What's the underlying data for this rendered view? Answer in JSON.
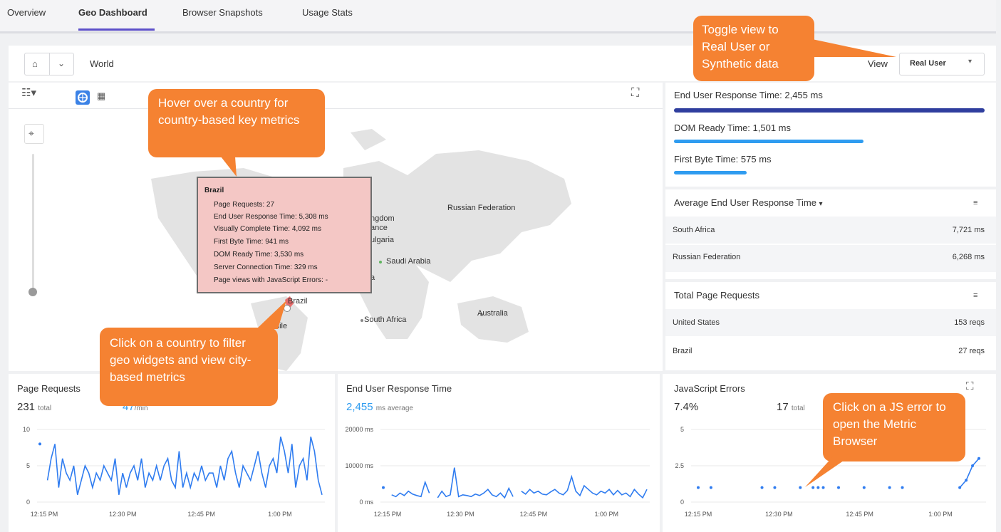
{
  "tabs": [
    "Overview",
    "Geo Dashboard",
    "Browser Snapshots",
    "Usage Stats"
  ],
  "breadcrumb": {
    "location": "World"
  },
  "view": {
    "label": "View",
    "selected": "Real User"
  },
  "callouts": {
    "toggle": "Toggle view to Real User or Synthetic data",
    "hover": "Hover over a country for country-based key metrics",
    "click": "Click on a country to filter geo widgets and view city-based metrics",
    "js": "Click on a JS error to open the Metric Browser"
  },
  "tooltip": {
    "title": "Brazil",
    "lines": [
      "Page Requests: 27",
      "End User Response Time: 5,308 ms",
      "Visually Complete Time: 4,092 ms",
      "First Byte Time: 941 ms",
      "DOM Ready Time: 3,530 ms",
      "Server Connection Time: 329 ms",
      "Page views with JavaScript Errors: -"
    ]
  },
  "map_labels": {
    "russia": "Russian Federation",
    "kingdom": "ngdom",
    "bulgaria": "ulgaria",
    "saudi": "Saudi Arabia",
    "south_africa": "South Africa",
    "australia": "Australia",
    "brazil": "Brazil",
    "chile": "hile",
    "partial_a": "a",
    "partial_gdom": "ance"
  },
  "metrics": {
    "eurt": {
      "label": "End User Response Time: 2,455 ms",
      "fraction": 1.0,
      "color": "#2f3e9e"
    },
    "dom": {
      "label": "DOM Ready Time: 1,501 ms",
      "fraction": 0.611,
      "color": "#2f9cf0"
    },
    "fbt": {
      "label": "First Byte Time: 575 ms",
      "fraction": 0.234,
      "color": "#2f9cf0"
    }
  },
  "avg_eurt": {
    "title": "Average End User Response Time",
    "rows": [
      {
        "name": "South Africa",
        "value": "7,721 ms"
      },
      {
        "name": "Russian Federation",
        "value": "6,268 ms"
      }
    ]
  },
  "total_page_requests": {
    "title": "Total Page Requests",
    "rows": [
      {
        "name": "United States",
        "value": "153 reqs"
      },
      {
        "name": "Brazil",
        "value": "27 reqs"
      }
    ]
  },
  "widgets": {
    "page_requests": {
      "title": "Page Requests",
      "total": "231",
      "total_label": "total",
      "rate": "47",
      "rate_label": "/min"
    },
    "eurt": {
      "title": "End User Response Time",
      "value": "2,455",
      "value_label": "ms average"
    },
    "js_errors": {
      "title": "JavaScript Errors",
      "pct": "7.4%",
      "total": "17",
      "total_label": "total"
    }
  },
  "chart_data": [
    {
      "type": "line",
      "title": "Page Requests",
      "x_ticks": [
        "12:15 PM",
        "12:30 PM",
        "12:45 PM",
        "1:00 PM"
      ],
      "y_ticks": [
        "10",
        "5",
        "0"
      ],
      "ylim": [
        0,
        10
      ],
      "values": [
        8,
        null,
        3,
        6,
        8,
        2,
        6,
        4,
        3,
        5,
        1,
        3,
        5,
        4,
        2,
        4,
        3,
        5,
        4,
        3,
        6,
        1,
        4,
        2,
        4,
        5,
        3,
        6,
        2,
        4,
        3,
        5,
        3,
        5,
        6,
        3,
        2,
        7,
        2,
        4,
        2,
        4,
        3,
        5,
        3,
        4,
        4,
        2,
        5,
        3,
        6,
        7,
        4,
        2,
        5,
        4,
        3,
        5,
        7,
        4,
        2,
        5,
        6,
        4,
        9,
        7,
        4,
        8,
        2,
        5,
        6,
        3,
        9,
        7,
        3,
        1
      ]
    },
    {
      "type": "line",
      "title": "End User Response Time",
      "x_ticks": [
        "12:15 PM",
        "12:30 PM",
        "12:45 PM",
        "1:00 PM"
      ],
      "y_ticks": [
        "20000 ms",
        "10000 ms",
        "0 ms"
      ],
      "ylim": [
        0,
        20000
      ],
      "values": [
        4000,
        null,
        2000,
        1500,
        2500,
        1800,
        3000,
        2200,
        1800,
        1500,
        5500,
        2500,
        null,
        1200,
        3000,
        1500,
        2000,
        9500,
        1500,
        2000,
        1800,
        1500,
        2200,
        1800,
        2500,
        3500,
        2000,
        1500,
        2500,
        1200,
        3800,
        1500,
        null,
        3000,
        2200,
        3500,
        2500,
        3000,
        2200,
        2000,
        2800,
        3500,
        2500,
        2000,
        3200,
        7000,
        3000,
        1800,
        4500,
        3500,
        2500,
        2000,
        3000,
        2500,
        3500,
        2000,
        3200,
        2000,
        2500,
        1500,
        3500,
        2200,
        1200,
        3500
      ]
    },
    {
      "type": "scatter",
      "title": "JavaScript Errors",
      "x_ticks": [
        "12:15 PM",
        "12:30 PM",
        "12:45 PM",
        "1:00 PM"
      ],
      "y_ticks": [
        "5",
        "2.5",
        "0"
      ],
      "ylim": [
        0,
        5
      ],
      "points": [
        [
          0,
          1
        ],
        [
          1,
          1
        ],
        [
          5,
          1
        ],
        [
          6,
          1
        ],
        [
          8,
          1
        ],
        [
          9,
          1
        ],
        [
          9.4,
          1
        ],
        [
          9.8,
          1
        ],
        [
          11,
          1
        ],
        [
          13,
          1
        ],
        [
          15,
          1
        ],
        [
          16,
          1
        ],
        [
          20.5,
          1
        ],
        [
          21,
          1.5
        ],
        [
          21.5,
          2.5
        ],
        [
          22,
          3
        ]
      ]
    }
  ]
}
